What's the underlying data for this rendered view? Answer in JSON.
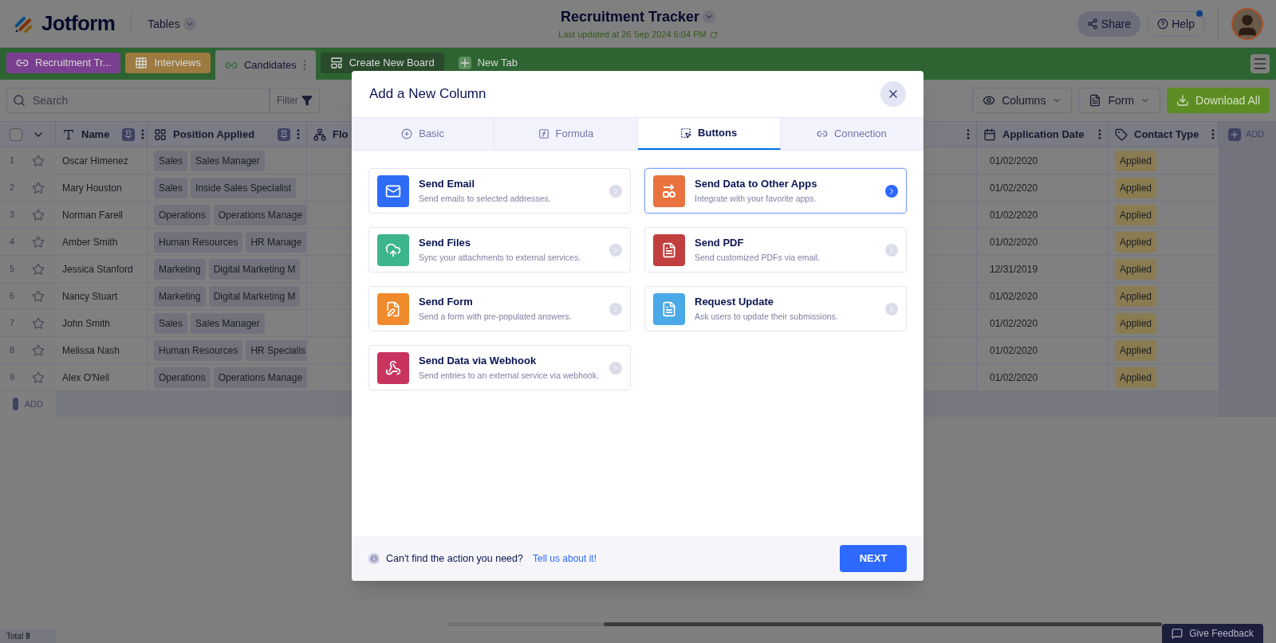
{
  "header": {
    "logo": "Jotform",
    "product": "Tables",
    "title": "Recruitment Tracker",
    "last_updated": "Last updated at 26 Sep 2024 6:04 PM",
    "share": "Share",
    "help": {
      "label": "Help",
      "notification": true
    }
  },
  "tabs": [
    {
      "label": "Recruitment Tr...",
      "kind": "link",
      "color": "#7b3f91",
      "selected": false
    },
    {
      "label": "Interviews",
      "kind": "table",
      "color": "#9d7a3f",
      "selected": false
    },
    {
      "label": "Candidates",
      "kind": "link",
      "color": "#7f7f80",
      "selected": true
    },
    {
      "label": "Create New Board",
      "kind": "board",
      "color": "#2a4a2c",
      "selected": false
    },
    {
      "label": "New Tab",
      "kind": "add",
      "color": "#2d6431",
      "selected": false
    }
  ],
  "toolbar": {
    "search_placeholder": "Search",
    "filter": "Filter",
    "columns": "Columns",
    "form": "Form",
    "download": "Download All"
  },
  "table": {
    "select_all": {
      "checked": false
    },
    "columns": [
      {
        "label": "Name",
        "kind": "text",
        "pinned": true
      },
      {
        "label": "Position Applied",
        "kind": "options",
        "pinned": true
      },
      {
        "label": "Flo",
        "kind": "flow",
        "pinned": false
      },
      {
        "label": "Application Date",
        "kind": "date",
        "pinned": false
      },
      {
        "label": "Contact Type",
        "kind": "tag",
        "pinned": false
      }
    ],
    "add_column": "ADD",
    "rows": [
      {
        "number": "1",
        "starred": false,
        "name": "Oscar Himenez",
        "tags": [
          "Sales",
          "Sales Manager"
        ],
        "date": "01/02/2020",
        "contact_type": "Applied"
      },
      {
        "number": "2",
        "starred": false,
        "name": "Mary Houston",
        "tags": [
          "Sales",
          "Inside Sales Specialist"
        ],
        "date": "01/02/2020",
        "contact_type": "Applied"
      },
      {
        "number": "3",
        "starred": false,
        "name": "Norman Farell",
        "tags": [
          "Operations",
          "Operations Manage"
        ],
        "date": "01/02/2020",
        "contact_type": "Applied"
      },
      {
        "number": "4",
        "starred": false,
        "name": "Amber Smith",
        "tags": [
          "Human Resources",
          "HR Manage"
        ],
        "date": "01/02/2020",
        "contact_type": "Applied"
      },
      {
        "number": "5",
        "starred": false,
        "name": "Jessica Stanford",
        "tags": [
          "Marketing",
          "Digital Marketing M"
        ],
        "date": "12/31/2019",
        "contact_type": "Applied"
      },
      {
        "number": "6",
        "starred": false,
        "name": "Nancy Stuart",
        "tags": [
          "Marketing",
          "Digital Marketing M"
        ],
        "date": "01/02/2020",
        "contact_type": "Applied"
      },
      {
        "number": "7",
        "starred": false,
        "name": "John Smith",
        "tags": [
          "Sales",
          "Sales Manager"
        ],
        "date": "01/02/2020",
        "contact_type": "Applied"
      },
      {
        "number": "8",
        "starred": false,
        "name": "Melissa Nash",
        "tags": [
          "Human Resources",
          "HR Specialis"
        ],
        "date": "01/02/2020",
        "contact_type": "Applied"
      },
      {
        "number": "9",
        "starred": false,
        "name": "Alex O'Neil",
        "tags": [
          "Operations",
          "Operations Manage"
        ],
        "date": "01/02/2020",
        "contact_type": "Applied"
      }
    ],
    "add_row": "ADD"
  },
  "status_bar": {
    "total": "Total **9**",
    "feedback": "Give Feedback"
  },
  "dialog": {
    "title": "Add a New Column",
    "tabs": [
      {
        "label": "Basic",
        "kind": "basic",
        "selected": false
      },
      {
        "label": "Formula",
        "kind": "formula",
        "selected": false
      },
      {
        "label": "Buttons",
        "kind": "buttons",
        "selected": true
      },
      {
        "label": "Connection",
        "kind": "connection",
        "selected": false
      }
    ],
    "actions": [
      {
        "title": "Send Email",
        "description": "Send emails to selected addresses.",
        "kind": "email",
        "color": "#2f6cf6",
        "selected": false
      },
      {
        "title": "Send Data to Other Apps",
        "description": "Integrate with your favorite apps.",
        "kind": "apps",
        "color": "#e8733e",
        "selected": true
      },
      {
        "title": "Send Files",
        "description": "Sync your attachments to external services.",
        "kind": "files",
        "color": "#3cb58a",
        "selected": false
      },
      {
        "title": "Send PDF",
        "description": "Send customized PDFs via email.",
        "kind": "pdf",
        "color": "#c1403f",
        "selected": false
      },
      {
        "title": "Send Form",
        "description": "Send a form with pre-populated answers.",
        "kind": "form",
        "color": "#f08a2a",
        "selected": false
      },
      {
        "title": "Request Update",
        "description": "Ask users to update their submissions.",
        "kind": "update",
        "color": "#4aa9e6",
        "selected": false
      },
      {
        "title": "Send Data via Webhook",
        "description": "Send entries to an external service via webhook.",
        "kind": "webhook",
        "color": "#c9345f",
        "selected": false
      }
    ],
    "footer_text": "Can't find the action you need?",
    "footer_link": "Tell us about it!",
    "next": "NEXT"
  }
}
